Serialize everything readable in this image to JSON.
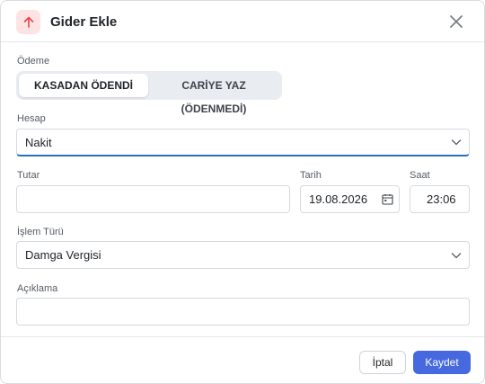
{
  "dialog": {
    "title": "Gider Ekle",
    "icon": "arrow-up-icon",
    "accent_color": "#e04848"
  },
  "payment": {
    "label": "Ödeme",
    "options": [
      "KASADAN ÖDENDİ",
      "CARİYE YAZ (ÖDENMEDİ)"
    ],
    "selected": "KASADAN ÖDENDİ"
  },
  "account": {
    "label": "Hesap",
    "value": "Nakit"
  },
  "amount": {
    "label": "Tutar",
    "value": ""
  },
  "date": {
    "label": "Tarih",
    "value": "19.08.2026"
  },
  "time": {
    "label": "Saat",
    "value": "23:06"
  },
  "transaction_type": {
    "label": "İşlem Türü",
    "value": "Damga Vergisi"
  },
  "description": {
    "label": "Açıklama",
    "value": ""
  },
  "footer": {
    "cancel_label": "İptal",
    "save_label": "Kaydet",
    "save_color": "#4769e0"
  }
}
